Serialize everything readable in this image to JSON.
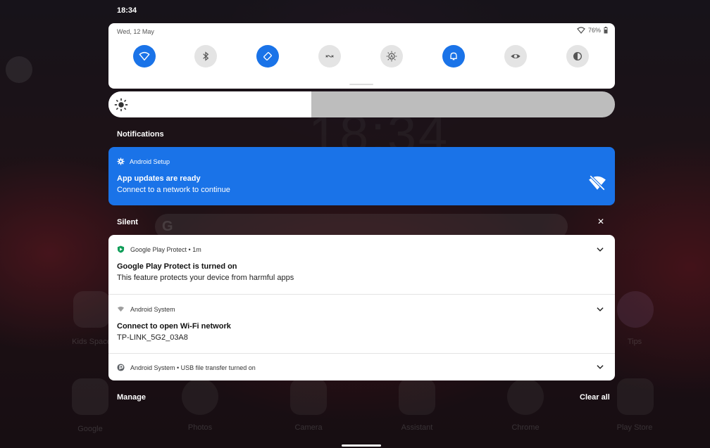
{
  "status_bar": {
    "time": "18:34"
  },
  "quick_settings": {
    "date": "Wed, 12 May",
    "battery": "76%",
    "tiles": [
      {
        "name": "wifi",
        "icon": "wifi-icon",
        "on": true
      },
      {
        "name": "bluetooth",
        "icon": "bluetooth-icon",
        "on": false
      },
      {
        "name": "auto-rotate",
        "icon": "rotate-icon",
        "on": true
      },
      {
        "name": "nfc",
        "icon": "nfc-icon",
        "on": false
      },
      {
        "name": "brightness-auto",
        "icon": "auto-brightness-icon",
        "on": false
      },
      {
        "name": "do-not-disturb",
        "icon": "bell-icon",
        "on": true
      },
      {
        "name": "eye-comfort",
        "icon": "eye-icon",
        "on": false
      },
      {
        "name": "dark-theme",
        "icon": "contrast-icon",
        "on": false
      }
    ],
    "brightness_level": 0.4
  },
  "notifications": {
    "header": "Notifications",
    "android_setup": {
      "app": "Android Setup",
      "title": "App updates are ready",
      "text": "Connect to a network to continue"
    },
    "silent_header": "Silent",
    "items": [
      {
        "app": "Google Play Protect • 1m",
        "title": "Google Play Protect is turned on",
        "text": "This feature protects your device from harmful apps"
      },
      {
        "app": "Android System",
        "title": "Connect to open Wi-Fi network",
        "text": "TP-LINK_5G2_03A8"
      },
      {
        "app": "Android System • USB file transfer turned on"
      }
    ],
    "manage_label": "Manage",
    "clear_all_label": "Clear all"
  },
  "background": {
    "clock": "18:34",
    "apps": [
      "Kids Space",
      "Tips",
      "Google",
      "Photos",
      "Camera",
      "Assistant",
      "Chrome",
      "Play Store"
    ]
  },
  "colors": {
    "accent": "#1a73e8",
    "play_protect": "#0f9d58"
  }
}
